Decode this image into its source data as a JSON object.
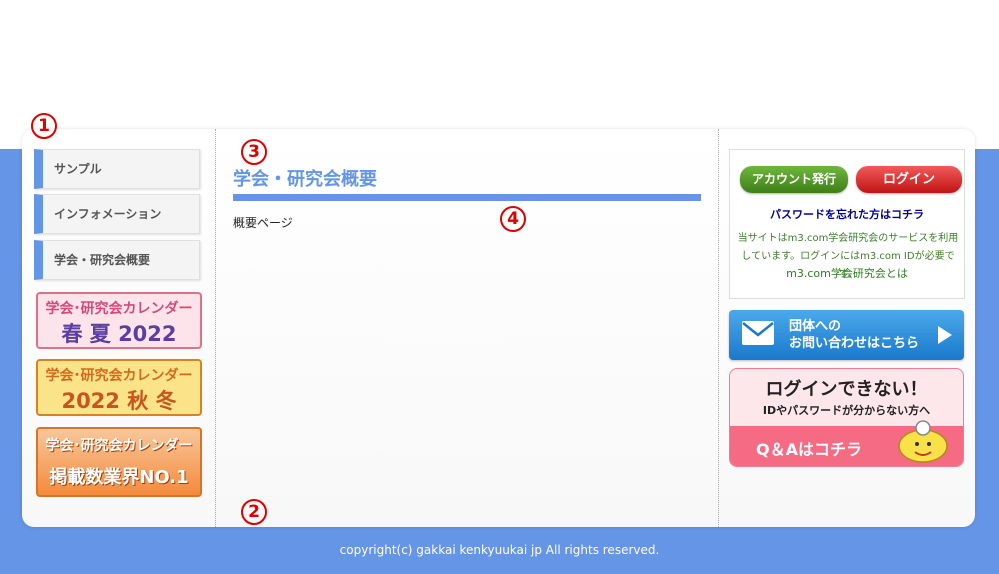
{
  "markers": {
    "m1": "1",
    "m2": "2",
    "m3": "3",
    "m4": "4"
  },
  "sidebar": {
    "items": [
      {
        "label": "サンプル"
      },
      {
        "label": "インフォメーション"
      },
      {
        "label": "学会・研究会概要"
      }
    ],
    "banners": [
      {
        "line1": "学会･研究会カレンダー",
        "line2": "春 夏 2022"
      },
      {
        "line1": "学会･研究会カレンダー",
        "line2": "2022 秋 冬"
      },
      {
        "line1": "学会･研究会カレンダー",
        "line2": "掲載数業界NO.1"
      }
    ]
  },
  "main": {
    "title": "学会・研究会概要",
    "body_text": "概要ページ"
  },
  "login": {
    "account_button": "アカウント発行",
    "login_button": "ログイン",
    "forgot_password": "パスワードを忘れた方はコチラ",
    "notice": "当サイトはm3.com学会研究会のサービスを利用しています。ログインにはm3.com IDが必要です。",
    "about_link": "m3.com学会研究会とは"
  },
  "contact": {
    "line1": "団体への",
    "line2": "お問い合わせはこちら"
  },
  "qa_banner": {
    "title": "ログインできない！",
    "subtitle": "IDやパスワードが分からない方へ",
    "link": "Q＆Aはコチラ"
  },
  "footer": {
    "copyright": "copyright(c) gakkai kenkyuukai jp All rights reserved."
  },
  "colors": {
    "accent": "#6495e6",
    "marker": "#e00000"
  }
}
